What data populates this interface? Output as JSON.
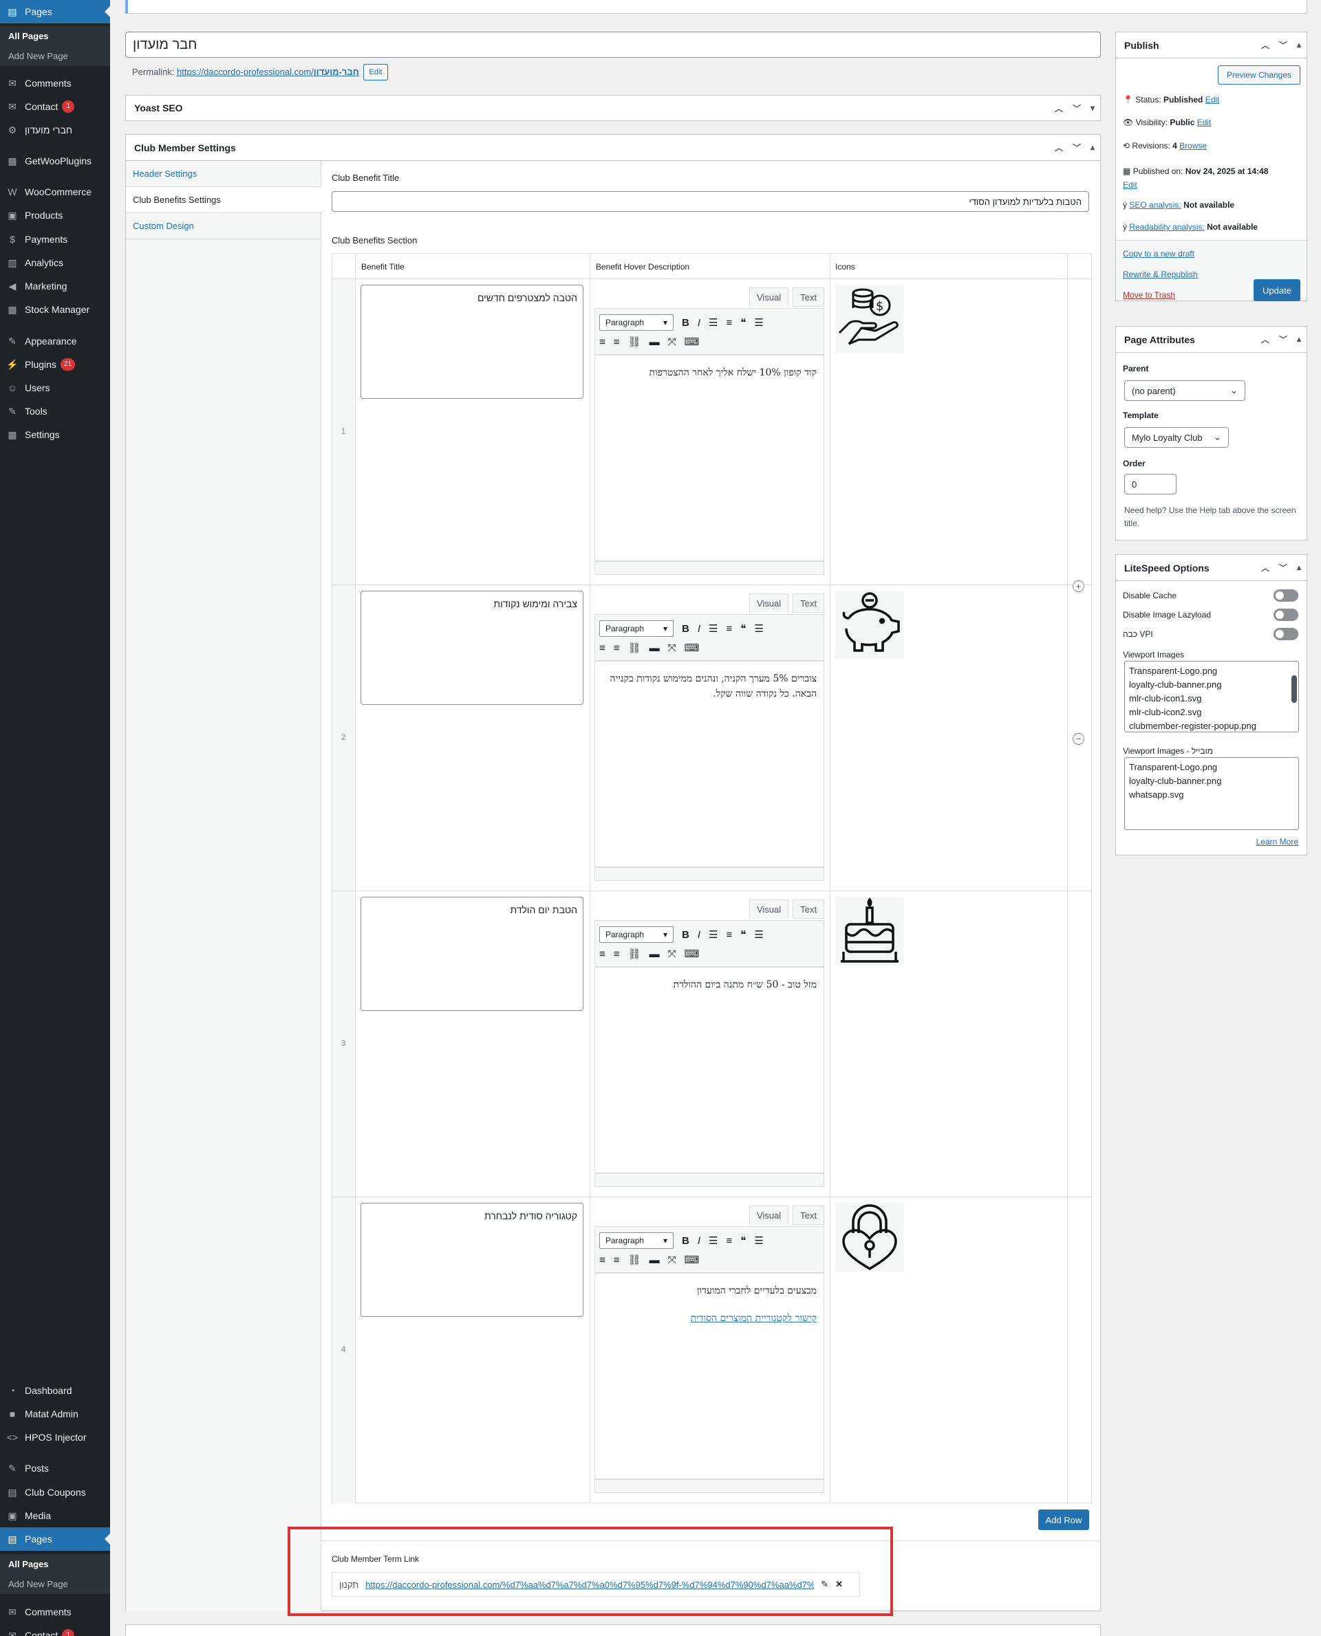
{
  "sidebar": {
    "items_top": [
      {
        "label": "Pages"
      },
      {
        "label": "Comments"
      },
      {
        "label": "Contact",
        "badge": "1"
      },
      {
        "label": "חברי מועדון"
      },
      {
        "label": "GetWooPlugins"
      },
      {
        "label": "WooCommerce"
      },
      {
        "label": "Products"
      },
      {
        "label": "Payments"
      },
      {
        "label": "Analytics"
      },
      {
        "label": "Marketing"
      },
      {
        "label": "Stock Manager"
      },
      {
        "label": "Appearance"
      },
      {
        "label": "Plugins",
        "badge": "21"
      },
      {
        "label": "Users"
      },
      {
        "label": "Tools"
      },
      {
        "label": "Settings"
      }
    ],
    "sub_pages": [
      "All Pages",
      "Add New Page"
    ],
    "items_bottom": [
      {
        "label": "Dashboard"
      },
      {
        "label": "Matat Admin"
      },
      {
        "label": "HPOS Injector"
      },
      {
        "label": "Posts"
      },
      {
        "label": "Club Coupons"
      },
      {
        "label": "Media"
      },
      {
        "label": "Pages"
      },
      {
        "label": "Comments"
      },
      {
        "label": "Contact",
        "badge": "1"
      }
    ],
    "sub_pages_bottom": [
      "All Pages",
      "Add New Page"
    ]
  },
  "post": {
    "title": "חבר מועדון",
    "permalink_label": "Permalink:",
    "permalink_url": "https://daccordo-professional.com/",
    "permalink_slug": "חבר-מועדון",
    "edit": "Edit"
  },
  "yoast": {
    "title": "Yoast SEO"
  },
  "club": {
    "title": "Club Member Settings",
    "tabs": [
      "Header Settings",
      "Club Benefits Settings",
      "Custom Design"
    ],
    "benefit_title_label": "Club Benefit Title",
    "benefit_title_value": "הטבות בלעדיות למועדון הסודי",
    "section_label": "Club Benefits Section",
    "columns": [
      "Benefit Title",
      "Benefit Hover Description",
      "Icons"
    ],
    "editor": {
      "visual": "Visual",
      "text": "Text",
      "format": "Paragraph"
    },
    "rows": [
      {
        "num": "1",
        "title": "הטבה למצטרפים חדשים",
        "desc": "קוד קופון 10% ישלח אליך לאחר ההצטרפות",
        "icon": "hand-coins-icon"
      },
      {
        "num": "2",
        "title": "צבירה ומימוש נקודות",
        "desc": "צוברים 5% מערך הקניה, ונהנים ממימוש נקודות בקנייה הבאה. כל נקודה שווה שקל.",
        "icon": "piggy-bank-icon"
      },
      {
        "num": "3",
        "title": "הטבת יום הולדת",
        "desc": "מזל טוב - 50 ש״ח מתנה ביום ההולדת",
        "icon": "birthday-cake-icon"
      },
      {
        "num": "4",
        "title": "קטגוריה סודית לנבחרת",
        "desc": "מבצעים בלעדיים לחברי המועדון",
        "desc_link": "קישור לקטגוריית המוצרים הסודית",
        "icon": "heart-lock-icon"
      }
    ],
    "add_row": "Add Row",
    "term_link_label": "Club Member Term Link",
    "term_link_title": "תקנון",
    "term_link_url": "https://daccordo-professional.com/%d7%aa%d7%a7%d7%a0%d7%95%d7%9f-%d7%94%d7%90%d7%aa%d7%a8"
  },
  "publish": {
    "title": "Publish",
    "preview": "Preview Changes",
    "status_label": "Status:",
    "status": "Published",
    "visibility_label": "Visibility:",
    "visibility": "Public",
    "revisions_label": "Revisions:",
    "revisions": "4",
    "browse": "Browse",
    "published_label": "Published on:",
    "published": "Nov 24, 2025 at 14:48",
    "edit": "Edit",
    "seo_label": "SEO analysis:",
    "seo": "Not available",
    "read_label": "Readability analysis:",
    "read": "Not available",
    "copy": "Copy to a new draft",
    "rewrite": "Rewrite & Republish",
    "trash": "Move to Trash",
    "update": "Update"
  },
  "attributes": {
    "title": "Page Attributes",
    "parent_label": "Parent",
    "parent": "(no parent)",
    "template_label": "Template",
    "template": "Mylo Loyalty Club",
    "order_label": "Order",
    "order": "0",
    "help": "Need help? Use the Help tab above the screen title."
  },
  "litespeed": {
    "title": "LiteSpeed Options",
    "disable_cache": "Disable Cache",
    "disable_lazy": "Disable Image Lazyload",
    "vpi": "כבה VPI",
    "viewport_label": "Viewport Images",
    "viewport_images": [
      "Transparent-Logo.png",
      "loyalty-club-banner.png",
      "mlr-club-icon1.svg",
      "mlr-club-icon2.svg",
      "clubmember-register-popup.png"
    ],
    "viewport_mobile_label": "Viewport Images - מובייל",
    "viewport_mobile": [
      "Transparent-Logo.png",
      "loyalty-club-banner.png",
      "whatsapp.svg"
    ],
    "learn_more": "Learn More"
  },
  "colors": {
    "accent": "#2271b1",
    "sidebar": "#1d2327",
    "highlight": "#d63638"
  }
}
